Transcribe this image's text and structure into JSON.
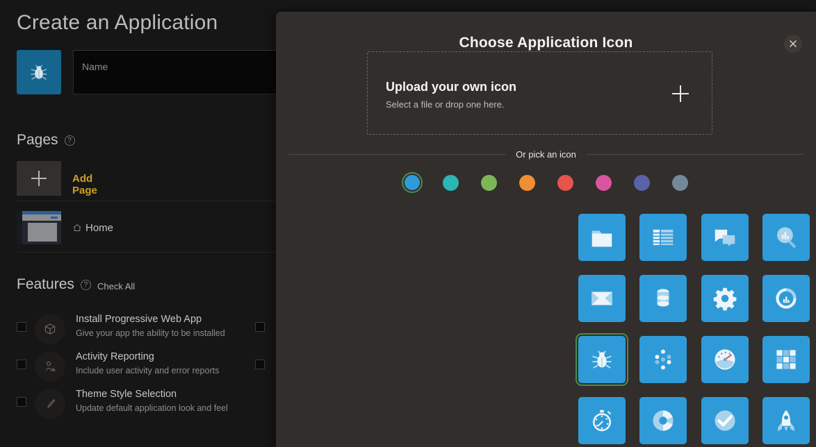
{
  "colors": {
    "page_bg": "#161616",
    "modal_bg": "#322e2b",
    "icon_tile_blue": "#2e9bd8",
    "accent_gold": "#c9a227",
    "selection_green": "#4b8b4f"
  },
  "builder": {
    "page_title": "Create an Application",
    "app_icon_name": "bug-icon",
    "name_field": {
      "value": "",
      "placeholder": "Name"
    },
    "pages": {
      "heading": "Pages",
      "help_icon": "question-circle-icon",
      "add_page_label": "Add Page",
      "items": [
        {
          "label": "Home",
          "icon": "home-icon"
        }
      ]
    },
    "features": {
      "heading": "Features",
      "help_icon": "question-circle-icon",
      "check_all_label": "Check All",
      "items": [
        {
          "title": "Install Progressive Web App",
          "subtitle": "Give your app the ability to be installed",
          "icon": "package-box-icon",
          "checked": false
        },
        {
          "title": "Activity Reporting",
          "subtitle": "Include user activity and error reports",
          "icon": "user-chart-icon",
          "checked": false
        },
        {
          "title": "Theme Style Selection",
          "subtitle": "Update default application look and feel",
          "icon": "paintbrush-icon",
          "checked": false
        }
      ]
    }
  },
  "dialog": {
    "title": "Choose Application Icon",
    "close_icon": "close-icon",
    "upload": {
      "title": "Upload your own icon",
      "subtitle": "Select a file or drop one here.",
      "plus_icon": "plus-icon"
    },
    "divider_label": "Or pick an icon",
    "swatches": [
      {
        "name": "blue",
        "hex": "#2e9bd8",
        "selected": true
      },
      {
        "name": "teal",
        "hex": "#2cb5b5",
        "selected": false
      },
      {
        "name": "green",
        "hex": "#7cb756",
        "selected": false
      },
      {
        "name": "orange",
        "hex": "#ef8f33",
        "selected": false
      },
      {
        "name": "red",
        "hex": "#e9534d",
        "selected": false
      },
      {
        "name": "pink",
        "hex": "#d9559f",
        "selected": false
      },
      {
        "name": "indigo",
        "hex": "#5a63a8",
        "selected": false
      },
      {
        "name": "slate",
        "hex": "#74889b",
        "selected": false
      }
    ],
    "icon_grid": {
      "columns": 8,
      "rows": 4,
      "selected_index": 16,
      "icons": [
        "folder-icon",
        "table-list-icon",
        "chat-bubbles-icon",
        "chart-search-icon",
        "chart-growth-icon",
        "calendar-icon",
        "cloud-icon",
        "cubes-icon",
        "envelope-icon",
        "database-icon",
        "gear-icon",
        "donut-gauge-icon",
        "map-pin-icon",
        "people-group-icon",
        "smiley-face-icon",
        "checklist-document-icon",
        "bug-icon",
        "dots-cluster-icon",
        "speedometer-icon",
        "grid-squares-icon",
        "document-edit-icon",
        "briefcase-icon",
        "tools-icon",
        "line-chart-icon",
        "stopwatch-icon",
        "pie-chart-icon",
        "check-circle-icon",
        "rocket-icon",
        "shield-icon",
        "lightbulb-icon",
        "lock-icon",
        "ship-icon"
      ]
    }
  }
}
